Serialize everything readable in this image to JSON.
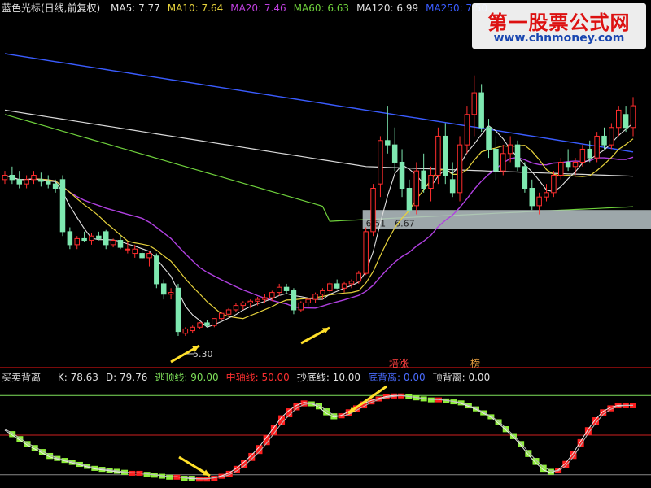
{
  "watermark": {
    "title": "第一股票公式网",
    "url": "www.chnmoney.com"
  },
  "top_header": {
    "name": "蓝色光标(日线,前复权)",
    "ma": [
      {
        "label": "MA5: 7.77",
        "color": "#e0e0e0"
      },
      {
        "label": "MA10: 7.64",
        "color": "#e6d23c"
      },
      {
        "label": "MA20: 7.46",
        "color": "#c040e0"
      },
      {
        "label": "MA60: 6.63",
        "color": "#6fd13c"
      },
      {
        "label": "MA120: 6.99",
        "color": "#e0e0e0"
      },
      {
        "label": "MA250: 7.50",
        "color": "#3a5cff"
      }
    ]
  },
  "bottom_header": {
    "name": "买卖背离",
    "items": [
      {
        "label": "K: 78.63",
        "color": "#e0e0e0"
      },
      {
        "label": "D: 79.76",
        "color": "#e0e0e0"
      },
      {
        "label": "逃顶线: 90.00",
        "color": "#7ee05a"
      },
      {
        "label": "中轴线: 50.00",
        "color": "#ff3030"
      },
      {
        "label": "抄底线: 10.00",
        "color": "#e0e0e0"
      },
      {
        "label": "底背离: 0.00",
        "color": "#4a6cff"
      },
      {
        "label": "顶背离: 0.00",
        "color": "#e0e0e0"
      }
    ]
  },
  "annotations": {
    "low_price": "5.30",
    "zone_label": "6.51 - 6.67",
    "top_signal_1": "培涨",
    "top_signal_2": "榜"
  },
  "colors": {
    "up": "#ff2d2d",
    "down": "#7ee8b0",
    "ma5": "#e0e0e0",
    "ma10": "#e6d23c",
    "ma20": "#b040e0",
    "ma60": "#6fd13c",
    "ma120": "#d8d8d8",
    "ma250": "#3a5cff",
    "zone": "#b8c4c8",
    "arrow": "#ffe02a",
    "kd_up": "#ff2020",
    "kd_down": "#8ef03a"
  },
  "chart_data": {
    "type": "candlestick",
    "title": "蓝色光标(日线,前复权)",
    "ylim": [
      5.0,
      9.0
    ],
    "candles": [
      [
        7.1,
        7.2,
        7.05,
        7.15
      ],
      [
        7.15,
        7.25,
        7.05,
        7.1
      ],
      [
        7.1,
        7.2,
        7.0,
        7.05
      ],
      [
        7.05,
        7.15,
        7.0,
        7.1
      ],
      [
        7.1,
        7.2,
        7.05,
        7.15
      ],
      [
        7.1,
        7.18,
        7.02,
        7.08
      ],
      [
        7.08,
        7.15,
        7.0,
        7.05
      ],
      [
        7.05,
        7.1,
        6.95,
        7.0
      ],
      [
        7.1,
        7.15,
        6.45,
        6.5
      ],
      [
        6.5,
        6.55,
        6.3,
        6.35
      ],
      [
        6.35,
        6.45,
        6.3,
        6.42
      ],
      [
        6.42,
        6.5,
        6.38,
        6.4
      ],
      [
        6.4,
        6.48,
        6.35,
        6.45
      ],
      [
        6.45,
        6.5,
        6.4,
        6.42
      ],
      [
        6.5,
        6.52,
        6.3,
        6.35
      ],
      [
        6.35,
        6.42,
        6.32,
        6.4
      ],
      [
        6.4,
        6.45,
        6.3,
        6.32
      ],
      [
        6.3,
        6.38,
        6.25,
        6.3
      ],
      [
        6.25,
        6.35,
        6.2,
        6.3
      ],
      [
        6.25,
        6.3,
        6.18,
        6.2
      ],
      [
        6.2,
        6.28,
        6.1,
        6.25
      ],
      [
        6.22,
        6.25,
        5.85,
        5.9
      ],
      [
        5.9,
        5.95,
        5.72,
        5.78
      ],
      [
        5.78,
        5.85,
        5.72,
        5.8
      ],
      [
        5.85,
        5.9,
        5.3,
        5.35
      ],
      [
        5.33,
        5.4,
        5.3,
        5.38
      ],
      [
        5.36,
        5.42,
        5.33,
        5.4
      ],
      [
        5.4,
        5.46,
        5.38,
        5.45
      ],
      [
        5.45,
        5.48,
        5.4,
        5.42
      ],
      [
        5.42,
        5.5,
        5.4,
        5.5
      ],
      [
        5.5,
        5.58,
        5.48,
        5.56
      ],
      [
        5.55,
        5.62,
        5.52,
        5.6
      ],
      [
        5.6,
        5.68,
        5.58,
        5.65
      ],
      [
        5.65,
        5.7,
        5.6,
        5.68
      ],
      [
        5.68,
        5.72,
        5.62,
        5.7
      ],
      [
        5.7,
        5.75,
        5.65,
        5.72
      ],
      [
        5.72,
        5.78,
        5.68,
        5.74
      ],
      [
        5.74,
        5.82,
        5.7,
        5.8
      ],
      [
        5.8,
        5.9,
        5.76,
        5.86
      ],
      [
        5.86,
        5.9,
        5.78,
        5.82
      ],
      [
        5.82,
        5.85,
        5.55,
        5.6
      ],
      [
        5.6,
        5.7,
        5.58,
        5.68
      ],
      [
        5.68,
        5.74,
        5.64,
        5.72
      ],
      [
        5.72,
        5.8,
        5.68,
        5.78
      ],
      [
        5.78,
        5.85,
        5.72,
        5.82
      ],
      [
        5.82,
        5.92,
        5.78,
        5.9
      ],
      [
        5.9,
        5.95,
        5.84,
        5.85
      ],
      [
        5.85,
        5.92,
        5.8,
        5.9
      ],
      [
        5.9,
        5.95,
        5.85,
        5.93
      ],
      [
        5.93,
        6.05,
        5.9,
        6.02
      ],
      [
        6.02,
        6.55,
        6.0,
        6.5
      ],
      [
        6.5,
        7.05,
        6.45,
        7.0
      ],
      [
        7.05,
        7.6,
        6.9,
        7.55
      ],
      [
        7.55,
        7.95,
        7.4,
        7.5
      ],
      [
        7.5,
        7.7,
        7.2,
        7.3
      ],
      [
        7.3,
        7.45,
        6.9,
        7.0
      ],
      [
        7.0,
        7.1,
        6.7,
        6.75
      ],
      [
        6.8,
        7.3,
        6.7,
        7.2
      ],
      [
        7.2,
        7.4,
        6.95,
        7.0
      ],
      [
        7.0,
        7.25,
        6.85,
        7.15
      ],
      [
        7.15,
        7.7,
        7.05,
        7.6
      ],
      [
        7.6,
        7.75,
        7.05,
        7.15
      ],
      [
        7.1,
        7.3,
        6.9,
        6.95
      ],
      [
        6.95,
        7.6,
        6.85,
        7.5
      ],
      [
        7.5,
        7.95,
        7.4,
        7.85
      ],
      [
        7.85,
        8.3,
        7.6,
        8.1
      ],
      [
        8.1,
        8.2,
        7.65,
        7.7
      ],
      [
        7.7,
        7.8,
        7.35,
        7.45
      ],
      [
        7.45,
        7.6,
        7.1,
        7.2
      ],
      [
        7.2,
        7.5,
        7.15,
        7.4
      ],
      [
        7.4,
        7.6,
        7.3,
        7.5
      ],
      [
        7.5,
        7.55,
        7.2,
        7.25
      ],
      [
        7.25,
        7.3,
        6.95,
        7.0
      ],
      [
        7.0,
        7.1,
        6.75,
        6.8
      ],
      [
        6.8,
        6.95,
        6.7,
        6.9
      ],
      [
        6.9,
        7.05,
        6.85,
        6.95
      ],
      [
        6.95,
        7.2,
        6.9,
        7.15
      ],
      [
        7.15,
        7.35,
        7.1,
        7.3
      ],
      [
        7.3,
        7.45,
        7.2,
        7.25
      ],
      [
        7.25,
        7.35,
        7.15,
        7.3
      ],
      [
        7.3,
        7.5,
        7.25,
        7.45
      ],
      [
        7.45,
        7.55,
        7.3,
        7.35
      ],
      [
        7.35,
        7.65,
        7.3,
        7.6
      ],
      [
        7.6,
        7.7,
        7.45,
        7.5
      ],
      [
        7.5,
        7.75,
        7.45,
        7.7
      ],
      [
        7.7,
        7.95,
        7.6,
        7.9
      ],
      [
        7.85,
        7.95,
        7.65,
        7.7
      ],
      [
        7.7,
        8.05,
        7.6,
        7.95
      ]
    ],
    "zone": [
      6.51,
      6.67
    ],
    "low_marker_value": 5.3,
    "kd_ylim": [
      0,
      100
    ],
    "kd_lines": {
      "top": 90,
      "mid": 50,
      "bottom": 10
    },
    "k": [
      55,
      50,
      45,
      40,
      36,
      32,
      28,
      26,
      24,
      22,
      20,
      18,
      16,
      15,
      14,
      13,
      12,
      12,
      12,
      11,
      10,
      9,
      8,
      8,
      7,
      6,
      6,
      6,
      7,
      9,
      12,
      17,
      23,
      30,
      38,
      48,
      58,
      68,
      75,
      80,
      83,
      82,
      78,
      72,
      68,
      70,
      74,
      78,
      82,
      85,
      87,
      89,
      90,
      90,
      89,
      88,
      87,
      86,
      86,
      85,
      84,
      82,
      79,
      76,
      72,
      68,
      62,
      55,
      48,
      40,
      30,
      22,
      15,
      12,
      15,
      22,
      32,
      44,
      56,
      66,
      74,
      78,
      80,
      80,
      80
    ],
    "d": [
      56,
      52,
      47,
      42,
      38,
      34,
      30,
      27,
      25,
      23,
      21,
      19,
      17,
      16,
      15,
      14,
      13,
      12,
      12,
      11,
      10,
      9,
      8,
      8,
      7,
      7,
      6,
      6,
      7,
      8,
      10,
      14,
      19,
      26,
      33,
      42,
      52,
      62,
      70,
      77,
      81,
      82,
      80,
      75,
      70,
      69,
      71,
      75,
      79,
      83,
      86,
      88,
      89,
      90,
      89,
      88,
      87,
      86,
      86,
      85,
      84,
      83,
      80,
      77,
      73,
      69,
      64,
      57,
      50,
      42,
      33,
      25,
      18,
      14,
      14,
      19,
      28,
      40,
      52,
      62,
      71,
      76,
      79,
      80,
      80
    ]
  }
}
